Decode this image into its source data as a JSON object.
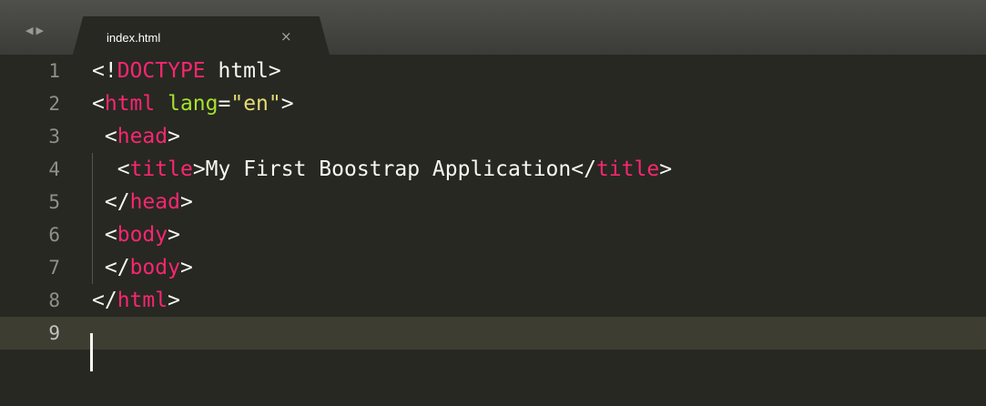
{
  "tabbar": {
    "back_arrow": "◀",
    "forward_arrow": "▶",
    "tab": {
      "label": "index.html",
      "close_glyph": "×"
    }
  },
  "editor": {
    "lines": [
      {
        "number": "1",
        "tokens": [
          {
            "t": "punc",
            "v": "<!"
          },
          {
            "t": "tag",
            "v": "DOCTYPE"
          },
          {
            "t": "text",
            "v": " html"
          },
          {
            "t": "punc",
            "v": ">"
          }
        ]
      },
      {
        "number": "2",
        "tokens": [
          {
            "t": "punc",
            "v": "<"
          },
          {
            "t": "tag",
            "v": "html"
          },
          {
            "t": "text",
            "v": " "
          },
          {
            "t": "attr",
            "v": "lang"
          },
          {
            "t": "punc",
            "v": "="
          },
          {
            "t": "str",
            "v": "\"en\""
          },
          {
            "t": "punc",
            "v": ">"
          }
        ]
      },
      {
        "number": "3",
        "tokens": [
          {
            "t": "text",
            "v": " "
          },
          {
            "t": "punc",
            "v": "<"
          },
          {
            "t": "tag",
            "v": "head"
          },
          {
            "t": "punc",
            "v": ">"
          }
        ]
      },
      {
        "number": "4",
        "tokens": [
          {
            "t": "text",
            "v": "  "
          },
          {
            "t": "punc",
            "v": "<"
          },
          {
            "t": "tag",
            "v": "title"
          },
          {
            "t": "punc",
            "v": ">"
          },
          {
            "t": "text",
            "v": "My First Boostrap Application"
          },
          {
            "t": "punc",
            "v": "</"
          },
          {
            "t": "tag",
            "v": "title"
          },
          {
            "t": "punc",
            "v": ">"
          }
        ]
      },
      {
        "number": "5",
        "tokens": [
          {
            "t": "text",
            "v": " "
          },
          {
            "t": "punc",
            "v": "</"
          },
          {
            "t": "tag",
            "v": "head"
          },
          {
            "t": "punc",
            "v": ">"
          }
        ]
      },
      {
        "number": "6",
        "tokens": [
          {
            "t": "text",
            "v": " "
          },
          {
            "t": "punc",
            "v": "<"
          },
          {
            "t": "tag",
            "v": "body"
          },
          {
            "t": "punc",
            "v": ">"
          }
        ]
      },
      {
        "number": "7",
        "tokens": [
          {
            "t": "text",
            "v": " "
          },
          {
            "t": "punc",
            "v": "</"
          },
          {
            "t": "tag",
            "v": "body"
          },
          {
            "t": "punc",
            "v": ">"
          }
        ]
      },
      {
        "number": "8",
        "tokens": [
          {
            "t": "punc",
            "v": "</"
          },
          {
            "t": "tag",
            "v": "html"
          },
          {
            "t": "punc",
            "v": ">"
          }
        ]
      },
      {
        "number": "9",
        "tokens": [],
        "active": true
      }
    ]
  },
  "colors": {
    "background": "#272822",
    "tag": "#f92672",
    "attribute": "#a6e22e",
    "string": "#e6db74",
    "text": "#f8f8f2",
    "line_number": "#8f908a",
    "active_line": "#3e3d32"
  }
}
